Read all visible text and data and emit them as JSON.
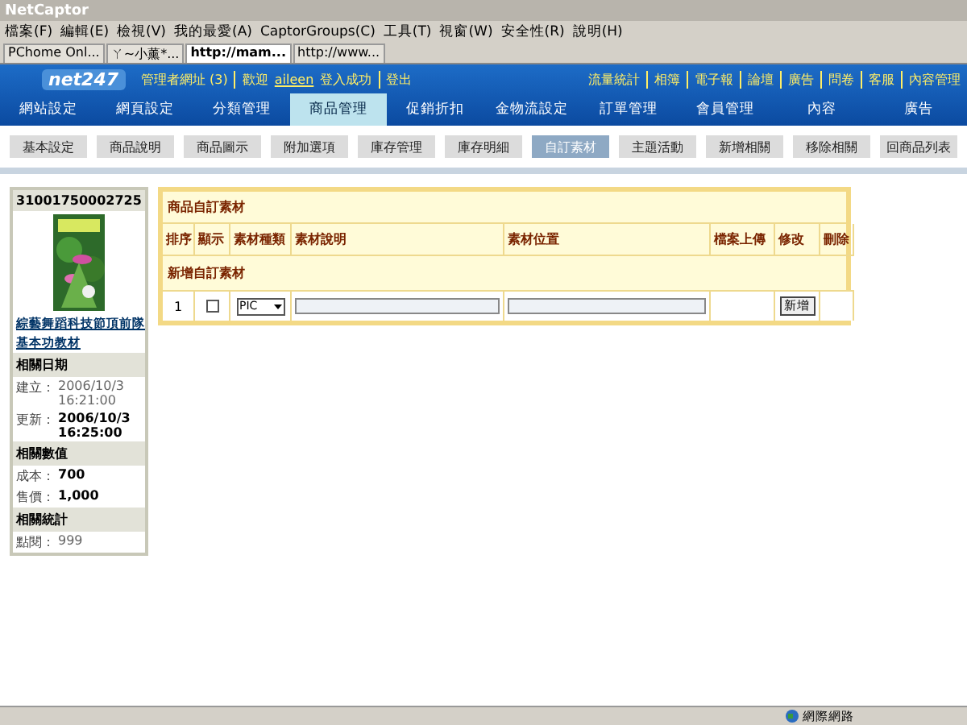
{
  "window": {
    "title": "NetCaptor"
  },
  "menu": [
    "檔案(F)",
    "編輯(E)",
    "檢視(V)",
    "我的最愛(A)",
    "CaptorGroups(C)",
    "工具(T)",
    "視窗(W)",
    "安全性(R)",
    "說明(H)"
  ],
  "browser_tabs": [
    {
      "label": "PChome Onl...",
      "selected": false
    },
    {
      "label": "ㄚ~小薰*...",
      "selected": false
    },
    {
      "label": "http://mam...",
      "selected": true
    },
    {
      "label": "http://www...",
      "selected": false
    }
  ],
  "header": {
    "logo": "net247",
    "admin": "管理者網址 (3)",
    "welcome": "歡迎",
    "user": "aileen",
    "login": "登入成功",
    "logout": "登出",
    "links": [
      "流量統計",
      "相簿",
      "電子報",
      "論壇",
      "廣告",
      "問卷",
      "客服",
      "內容管理"
    ]
  },
  "main_nav": [
    {
      "label": "網站設定",
      "selected": false
    },
    {
      "label": "網頁設定",
      "selected": false
    },
    {
      "label": "分類管理",
      "selected": false
    },
    {
      "label": "商品管理",
      "selected": true
    },
    {
      "label": "促銷折扣",
      "selected": false
    },
    {
      "label": "金物流設定",
      "selected": false
    },
    {
      "label": "訂單管理",
      "selected": false
    },
    {
      "label": "會員管理",
      "selected": false
    },
    {
      "label": "內容",
      "selected": false
    },
    {
      "label": "廣告",
      "selected": false
    }
  ],
  "sub_nav": [
    {
      "label": "基本設定",
      "selected": false
    },
    {
      "label": "商品說明",
      "selected": false
    },
    {
      "label": "商品圖示",
      "selected": false
    },
    {
      "label": "附加選項",
      "selected": false
    },
    {
      "label": "庫存管理",
      "selected": false
    },
    {
      "label": "庫存明細",
      "selected": false
    },
    {
      "label": "自訂素材",
      "selected": true
    },
    {
      "label": "主題活動",
      "selected": false
    },
    {
      "label": "新增相關",
      "selected": false
    },
    {
      "label": "移除相關",
      "selected": false
    },
    {
      "label": "回商品列表",
      "selected": false
    }
  ],
  "sidebar": {
    "code": "31001750002725",
    "picture": {
      "kind": "picture"
    },
    "links": [
      "綜藝舞蹈科技節頂前隊",
      "基本功教材"
    ],
    "sections": [
      {
        "title": "相關日期",
        "rows": [
          {
            "label": "建立：",
            "value": "2006/10/3 16:21:00",
            "bold": false
          },
          {
            "label": "更新：",
            "value": "2006/10/3 16:25:00",
            "bold": true
          }
        ]
      },
      {
        "title": "相關數值",
        "rows": [
          {
            "label": "成本：",
            "value": "700",
            "bold": true
          },
          {
            "label": "售價：",
            "value": "1,000",
            "bold": true
          }
        ]
      },
      {
        "title": "相關統計",
        "rows": [
          {
            "label": "點閱：",
            "value": "999",
            "bold": false
          }
        ]
      }
    ]
  },
  "panel": {
    "title": "商品自訂素材",
    "columns": [
      "排序",
      "顯示",
      "素材種類",
      "素材說明",
      "素材位置",
      "檔案上傳",
      "修改",
      "刪除"
    ],
    "add_label": "新增自訂素材",
    "row": {
      "order": "1",
      "checked": false,
      "type": "PIC",
      "button": "新增"
    }
  },
  "status_bar": {
    "zone": "網際網路"
  }
}
